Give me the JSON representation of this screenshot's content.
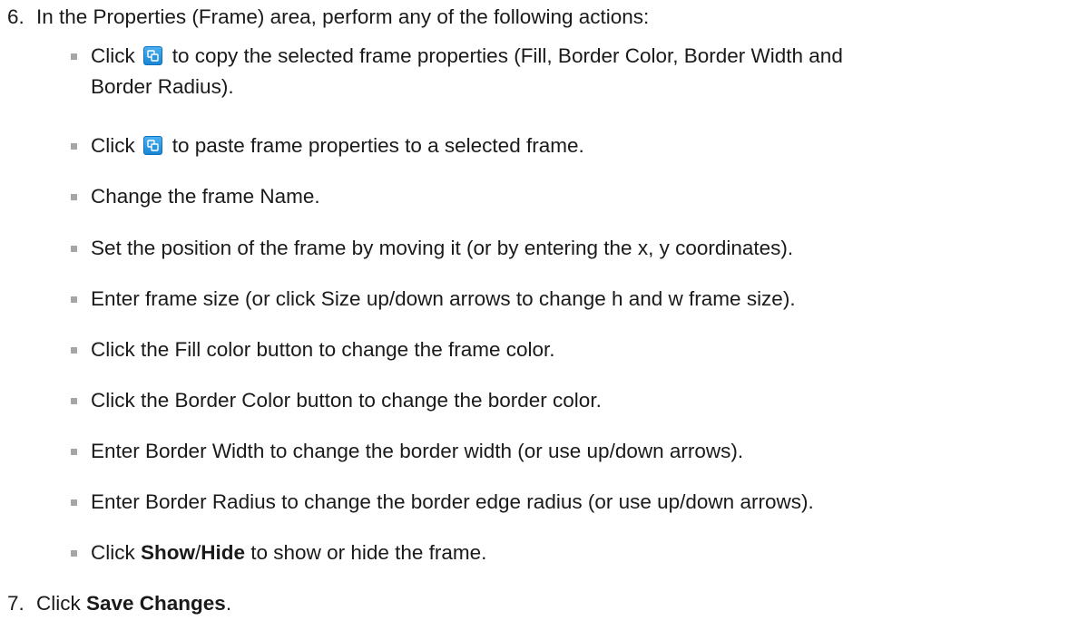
{
  "steps": {
    "step6": {
      "number": "6.",
      "text": "In the Properties (Frame) area, perform any of the following actions:"
    },
    "step7": {
      "number": "7.",
      "pre": "Click ",
      "bold": "Save Changes",
      "post": "."
    }
  },
  "bullets": {
    "copy": {
      "pre": "Click",
      "line1": "to copy the selected frame properties (Fill, Border Color, Border Width and",
      "line2": "Border Radius).",
      "icon": "copy-properties-icon"
    },
    "paste": {
      "pre": "Click",
      "post": "to paste frame properties to a selected frame.",
      "icon": "paste-properties-icon"
    },
    "name": "Change the frame Name.",
    "position": "Set the position of the frame by moving it (or by entering the x, y coordinates).",
    "size": "Enter frame size (or click Size up/down arrows to change h and w frame size).",
    "fill": "Click the Fill color button to change the frame color.",
    "border_color": "Click the Border Color button to change the border color.",
    "border_width": "Enter Border Width to change the border width (or use up/down arrows).",
    "border_radius": "Enter Border Radius to change the border edge radius (or use up/down arrows).",
    "show_hide": {
      "pre": "Click ",
      "show": "Show",
      "slash": "/",
      "hide": "Hide",
      "post": " to show or hide the frame."
    }
  },
  "colors": {
    "text": "#1a1a1a",
    "bullet": "#a6a6a6",
    "icon_blue": "#1a86d6"
  }
}
